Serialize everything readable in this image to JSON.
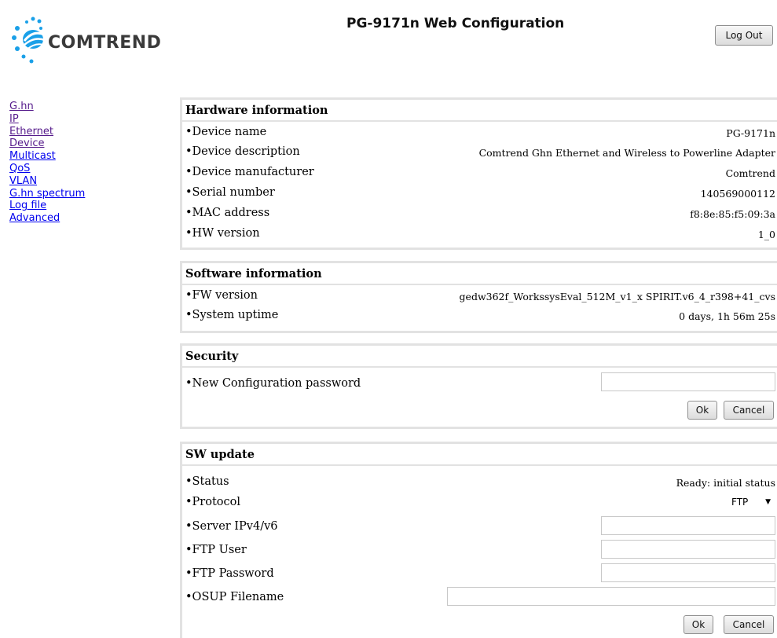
{
  "header": {
    "logo_text": "COMTREND",
    "title": "PG-9171n Web Configuration",
    "logout_label": "Log Out"
  },
  "sidebar": {
    "items": [
      {
        "label": "G.hn",
        "state": "visited"
      },
      {
        "label": "IP",
        "state": "visited"
      },
      {
        "label": "Ethernet",
        "state": "visited"
      },
      {
        "label": "Device",
        "state": "visited"
      },
      {
        "label": "Multicast",
        "state": "link"
      },
      {
        "label": "QoS",
        "state": "link"
      },
      {
        "label": "VLAN",
        "state": "link"
      },
      {
        "label": "G.hn spectrum",
        "state": "link"
      },
      {
        "label": "Log file",
        "state": "link"
      },
      {
        "label": "Advanced",
        "state": "link"
      }
    ]
  },
  "hardware": {
    "title": "Hardware information",
    "rows": [
      {
        "label": "•Device name",
        "value": "PG-9171n"
      },
      {
        "label": "•Device description",
        "value": "Comtrend Ghn Ethernet and Wireless to Powerline Adapter"
      },
      {
        "label": "•Device manufacturer",
        "value": "Comtrend"
      },
      {
        "label": "•Serial number",
        "value": "140569000112"
      },
      {
        "label": "•MAC address",
        "value": "f8:8e:85:f5:09:3a"
      },
      {
        "label": "•HW version",
        "value": "1_0"
      }
    ]
  },
  "software": {
    "title": "Software information",
    "rows": [
      {
        "label": "•FW version",
        "value": "gedw362f_WorkssysEval_512M_v1_x SPIRIT.v6_4_r398+41_cvs"
      },
      {
        "label": "•System uptime",
        "value": "0 days, 1h 56m 25s"
      }
    ]
  },
  "security": {
    "title": "Security",
    "password_label": "•New Configuration password",
    "password_value": "",
    "ok_label": "Ok",
    "cancel_label": "Cancel"
  },
  "sw_update": {
    "title": "SW update",
    "status_label": "•Status",
    "status_value": "Ready: initial status",
    "protocol_label": "•Protocol",
    "protocol_value": "FTP",
    "server_label": "•Server IPv4/v6",
    "server_value": "",
    "ftp_user_label": "•FTP User",
    "ftp_user_value": "",
    "ftp_password_label": "•FTP Password",
    "ftp_password_value": "",
    "osup_label": "•OSUP Filename",
    "osup_value": "",
    "ok_label": "Ok",
    "cancel_label": "Cancel"
  },
  "colors": {
    "link": "#0000ee",
    "visited_link": "#551a8b",
    "logo_blue": "#1aa0e8",
    "panel_border": "#e2e2e2"
  }
}
